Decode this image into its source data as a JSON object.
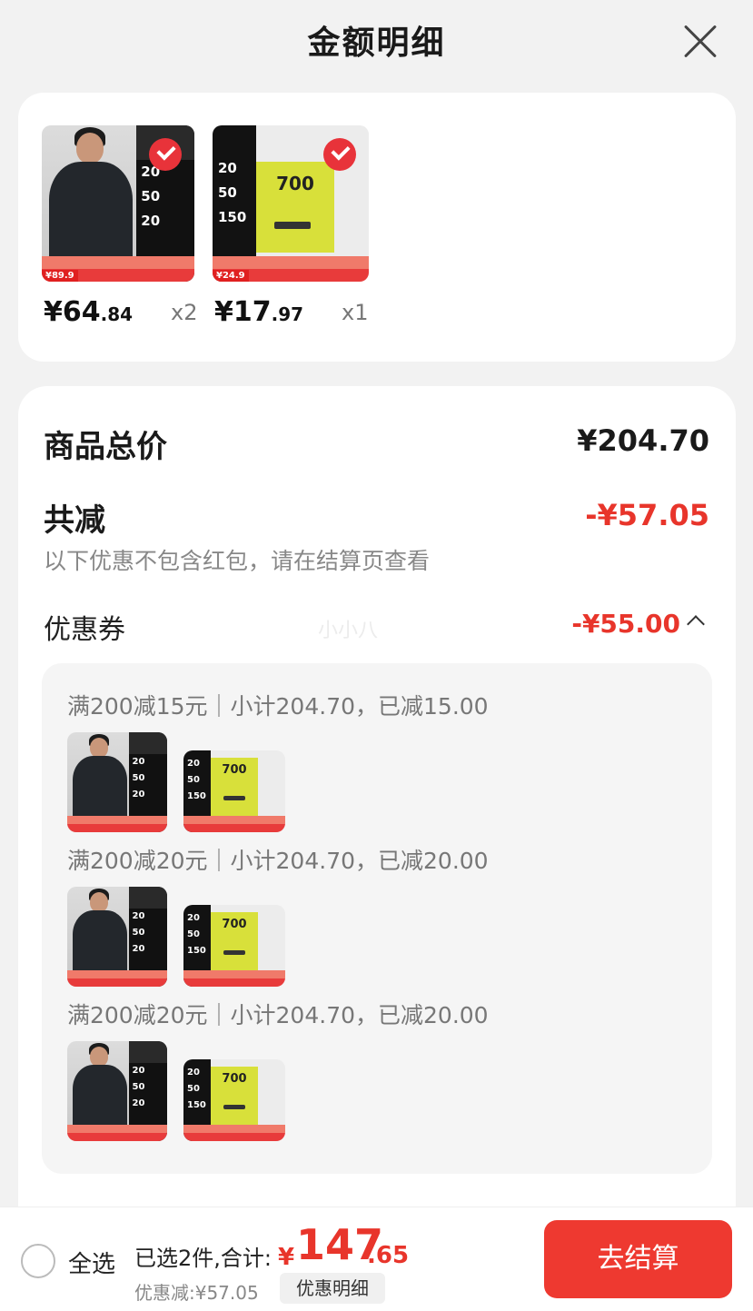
{
  "header": {
    "title": "金额明细"
  },
  "products": [
    {
      "price_int": "¥64",
      "price_dec": ".84",
      "qty": "x2",
      "kind": "jacket",
      "chip": "¥89.9"
    },
    {
      "price_int": "¥17",
      "price_dec": ".97",
      "qty": "x1",
      "kind": "yellow",
      "chip": "¥24.9"
    }
  ],
  "summary": {
    "total_label": "商品总价",
    "total_value": "¥204.70",
    "reduce_label": "共减",
    "reduce_value": "-¥57.05",
    "note": "以下优惠不包含红包，请在结算页查看",
    "coupon_label": "优惠券",
    "coupon_value": "-¥55.00",
    "watermark": "小小八"
  },
  "coupon_lines": [
    "满200减15元｜小计204.70，已减15.00",
    "满200减20元｜小计204.70，已减20.00",
    "满200减20元｜小计204.70，已减20.00"
  ],
  "thumb_text": {
    "c1": "20",
    "c2": "50",
    "c3": "150",
    "c4": "20",
    "num": "700"
  },
  "footer": {
    "select_all": "全选",
    "summary_text": "已选2件,合计:",
    "currency": "¥",
    "total_int": "147",
    "total_dec": ".65",
    "discount": "优惠减:¥57.05",
    "detail_button": "优惠明细",
    "checkout_button": "去结算"
  },
  "colors": {
    "accent": "#e8352b",
    "checkout": "#ee3930"
  }
}
